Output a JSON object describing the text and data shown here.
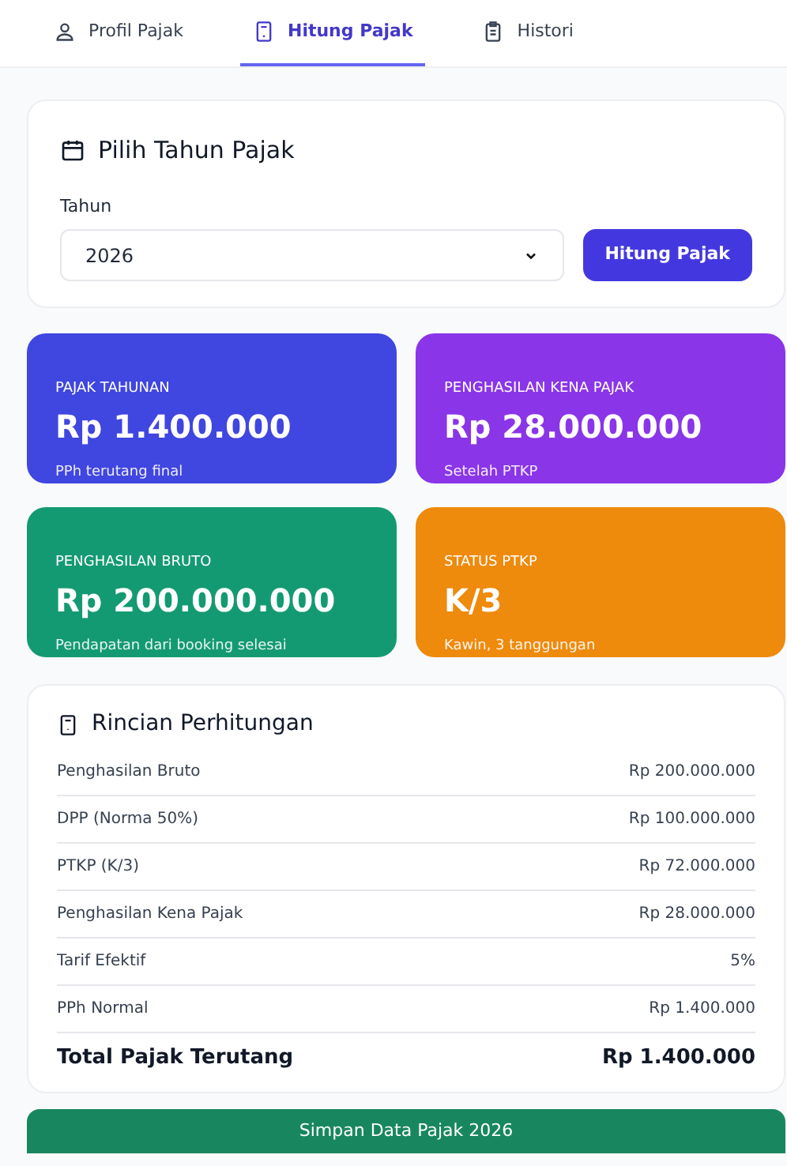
{
  "tabs": [
    {
      "label": "Profil Pajak",
      "kind": "user",
      "selected": false
    },
    {
      "label": "Hitung Pajak",
      "kind": "calculator",
      "selected": true
    },
    {
      "label": "Histori",
      "kind": "history",
      "selected": false
    }
  ],
  "year_card": {
    "title": "Pilih Tahun Pajak",
    "field_label": "Tahun",
    "year_value": "2026",
    "button": "Hitung Pajak"
  },
  "stats": [
    {
      "label": "PAJAK TAHUNAN",
      "value": "Rp 1.400.000",
      "note": "PPh terutang final",
      "color": "#4046e0"
    },
    {
      "label": "PENGHASILAN KENA PAJAK",
      "value": "Rp 28.000.000",
      "note": "Setelah PTKP",
      "color": "#8a35e8"
    },
    {
      "label": "PENGHASILAN BRUTO",
      "value": "Rp 200.000.000",
      "note": "Pendapatan dari booking selesai",
      "color": "#149a72"
    },
    {
      "label": "STATUS PTKP",
      "value": "K/3",
      "note": "Kawin, 3 tanggungan",
      "color": "#ee8a0c"
    }
  ],
  "breakdown": {
    "title": "Rincian Perhitungan",
    "rows": [
      {
        "label": "Penghasilan Bruto",
        "value": "Rp 200.000.000",
        "kind": "normal"
      },
      {
        "label": "DPP (Norma 50%)",
        "value": "Rp 100.000.000",
        "kind": "normal"
      },
      {
        "label": "PTKP (K/3)",
        "value": "Rp 72.000.000",
        "kind": "normal"
      },
      {
        "label": "Penghasilan Kena Pajak",
        "value": "Rp 28.000.000",
        "kind": "normal"
      },
      {
        "label": "Tarif Efektif",
        "value": "5%",
        "kind": "normal"
      },
      {
        "label": "PPh Normal",
        "value": "Rp 1.400.000",
        "kind": "normal"
      },
      {
        "label": "Total Pajak Terutang",
        "value": "Rp 1.400.000",
        "kind": "total"
      }
    ]
  },
  "save_button": "Simpan Data Pajak 2026"
}
